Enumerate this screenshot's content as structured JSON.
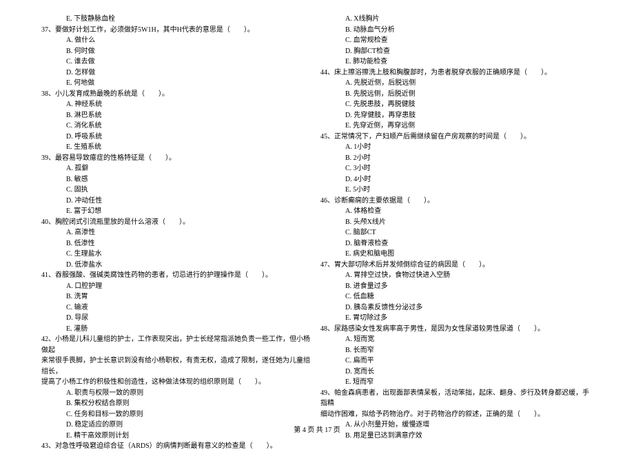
{
  "leftColumn": {
    "preOption": "E. 下肢静脉血栓",
    "q37": "37、要做好计划工作，必须做好5W1H，其中H代表的意思是（　　）。",
    "q37a": "A. 做什么",
    "q37b": "B. 何时做",
    "q37c": "C. 谁去做",
    "q37d": "D. 怎样做",
    "q37e": "E. 何地做",
    "q38": "38、小儿发育成熟最晚的系统是（　　）。",
    "q38a": "A. 神经系统",
    "q38b": "B. 淋巴系统",
    "q38c": "C. 消化系统",
    "q38d": "D. 呼吸系统",
    "q38e": "E. 生殖系统",
    "q39": "39、最容易导致癔症的性格特征是（　　）。",
    "q39a": "A. 孤僻",
    "q39b": "B. 敏感",
    "q39c": "C. 固执",
    "q39d": "D. 冲动任性",
    "q39e": "E. 富于幻想",
    "q40": "40、胸腔闭式引流瓶里放的是什么溶液（　　）。",
    "q40a": "A. 高渗性",
    "q40b": "B. 低渗性",
    "q40c": "C. 生理盐水",
    "q40d": "D. 低渗盐水",
    "q41": "41、吞服强酸、强碱类腐蚀性药物的患者，切忌进行的护理操作是（　　）。",
    "q41a": "A. 口腔护理",
    "q41b": "B. 洗胃",
    "q41c": "C. 输液",
    "q41d": "D. 导尿",
    "q41e": "E. 灌肠",
    "q42": "42、小杨是儿科儿童组的护士，工作表现突出，护士长经常指派她负责一些工作，但小杨做起",
    "q42line2": "来常很手畏脚，护士长意识到没有给小杨职权，有责无权，造成了限制，遂任她为儿童组组长，",
    "q42line3": "提高了小杨工作的积极性和创造性，这种做法体现的组织原则是（　　）。",
    "q42a": "A. 职责与权限一致的原则",
    "q42b": "B. 集权分权结合原则",
    "q42c": "C. 任务和目标一致的原则",
    "q42d": "D. 稳定适应的原则",
    "q42e": "E. 精干高效原则计划",
    "q43": "43、对急性呼吸窘迫综合征（ARDS）的病情判断最有意义的检查是（　　）。"
  },
  "rightColumn": {
    "q43a": "A. X线胸片",
    "q43b": "B. 动脉血气分析",
    "q43c": "C. 血常规检查",
    "q43d": "D. 胸部CT检查",
    "q43e": "E. 肺功能检查",
    "q44": "44、床上擦浴擦洗上肢和胸腹部时，为患者脱穿衣服的正确顺序是（　　）。",
    "q44a": "A. 先脱近侧，后脱远侧",
    "q44b": "B. 先脱远侧，后脱近侧",
    "q44c": "C. 先脱患肢，再脱健肢",
    "q44d": "D. 先穿健肢，再穿患肢",
    "q44e": "E. 先穿近侧，再穿远侧",
    "q45": "45、正常情况下，产妇顺产后需继续留在产房观察的时间是（　　）。",
    "q45a": "A. 1小时",
    "q45b": "B. 2小时",
    "q45c": "C. 3小时",
    "q45d": "D. 4小时",
    "q45e": "E. 5小时",
    "q46": "46、诊断癫痫的主要依据是（　　）。",
    "q46a": "A. 体格检查",
    "q46b": "B. 头颅X线片",
    "q46c": "C. 脑部CT",
    "q46d": "D. 脑脊液检查",
    "q46e": "E. 病史和脑电图",
    "q47": "47、胃大部切除术后并发倾倒综合征的病因是（　　）。",
    "q47a": "A. 胃排空过快，食物过快进入空肠",
    "q47b": "B. 进食量过多",
    "q47c": "C. 低血糖",
    "q47d": "D. 胰岛素反馈性分泌过多",
    "q47e": "E. 胃切除过多",
    "q48": "48、尿路感染女性发病率高于男性，是因为女性尿道较男性尿道（　　）。",
    "q48a": "A. 短而宽",
    "q48b": "B. 长而窄",
    "q48c": "C. 扁而平",
    "q48d": "D. 宽而长",
    "q48e": "E. 短而窄",
    "q49": "49、帕金森病患者，出现面部表情呆板，活动笨拙，起床、翻身、步行及转身都迟缓，手指精",
    "q49line2": "细动作困难，拟给予药物治疗。对于药物治疗的叙述，正确的是（　　）。",
    "q49a": "A. 从小剂量开始，缓慢逐增",
    "q49b": "B. 用足量已达到满意疗效"
  },
  "footer": "第 4 页 共 17 页"
}
